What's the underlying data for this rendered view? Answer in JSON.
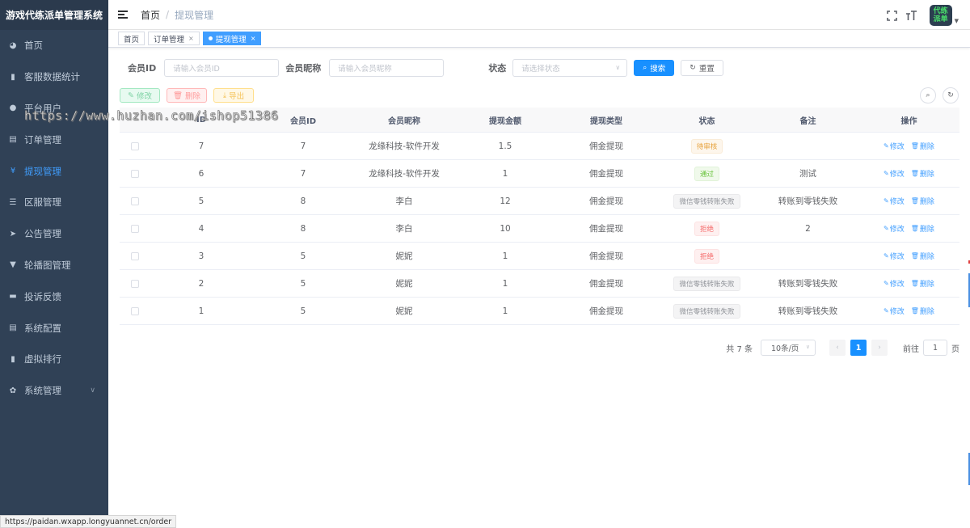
{
  "sidebar": {
    "logo": "游戏代练派单管理系统",
    "items": [
      {
        "label": "首页",
        "icon": "dashboard-icon",
        "glyph": "◕"
      },
      {
        "label": "客服数据统计",
        "icon": "chart-icon",
        "glyph": "▮"
      },
      {
        "label": "平台用户",
        "icon": "user-icon",
        "glyph": "●"
      },
      {
        "label": "订单管理",
        "icon": "order-icon",
        "glyph": "▤"
      },
      {
        "label": "提现管理",
        "icon": "yen-icon",
        "glyph": "¥"
      },
      {
        "label": "区服管理",
        "icon": "list-icon",
        "glyph": "☰"
      },
      {
        "label": "公告管理",
        "icon": "send-icon",
        "glyph": "➤"
      },
      {
        "label": "轮播图管理",
        "icon": "shirt-icon",
        "glyph": "▼"
      },
      {
        "label": "投诉反馈",
        "icon": "message-icon",
        "glyph": "▬"
      },
      {
        "label": "系统配置",
        "icon": "document-icon",
        "glyph": "▤"
      },
      {
        "label": "虚拟排行",
        "icon": "ranking-icon",
        "glyph": "▮"
      },
      {
        "label": "系统管理",
        "icon": "gear-icon",
        "glyph": "✿"
      }
    ],
    "active_index": 4
  },
  "header": {
    "breadcrumb": [
      "首页",
      "提现管理"
    ],
    "avatar_text": [
      "代练",
      "派单"
    ]
  },
  "tags": [
    {
      "label": "首页",
      "closable": false
    },
    {
      "label": "订单管理",
      "closable": true
    },
    {
      "label": "提现管理",
      "closable": true,
      "active": true
    }
  ],
  "search": {
    "member_id_label": "会员ID",
    "member_id_placeholder": "请输入会员ID",
    "nickname_label": "会员昵称",
    "nickname_placeholder": "请输入会员昵称",
    "status_label": "状态",
    "status_placeholder": "请选择状态",
    "search_btn": "搜索",
    "reset_btn": "重置"
  },
  "toolbar": {
    "edit": "修改",
    "delete": "删除",
    "export": "导出"
  },
  "table": {
    "columns": [
      "ID",
      "会员ID",
      "会员昵称",
      "提现金额",
      "提现类型",
      "状态",
      "备注",
      "操作"
    ],
    "rows": [
      {
        "id": "7",
        "member_id": "7",
        "nickname": "龙缘科技-软件开发",
        "amount": "1.5",
        "type": "佣金提现",
        "status": "待审核",
        "status_kind": "warn",
        "remark": ""
      },
      {
        "id": "6",
        "member_id": "7",
        "nickname": "龙缘科技-软件开发",
        "amount": "1",
        "type": "佣金提现",
        "status": "通过",
        "status_kind": "succ",
        "remark": "测试"
      },
      {
        "id": "5",
        "member_id": "8",
        "nickname": "李白",
        "amount": "12",
        "type": "佣金提现",
        "status": "微信零钱转账失败",
        "status_kind": "info",
        "remark": "转账到零钱失败"
      },
      {
        "id": "4",
        "member_id": "8",
        "nickname": "李白",
        "amount": "10",
        "type": "佣金提现",
        "status": "拒绝",
        "status_kind": "dang",
        "remark": "2"
      },
      {
        "id": "3",
        "member_id": "5",
        "nickname": "妮妮",
        "amount": "1",
        "type": "佣金提现",
        "status": "拒绝",
        "status_kind": "dang",
        "remark": ""
      },
      {
        "id": "2",
        "member_id": "5",
        "nickname": "妮妮",
        "amount": "1",
        "type": "佣金提现",
        "status": "微信零钱转账失败",
        "status_kind": "info",
        "remark": "转账到零钱失败"
      },
      {
        "id": "1",
        "member_id": "5",
        "nickname": "妮妮",
        "amount": "1",
        "type": "佣金提现",
        "status": "微信零钱转账失败",
        "status_kind": "info",
        "remark": "转账到零钱失败"
      }
    ],
    "op_edit": "修改",
    "op_delete": "删除"
  },
  "pagination": {
    "total_text": "共 7 条",
    "page_size": "10条/页",
    "current_page": "1",
    "goto_label": "前往",
    "goto_value": "1",
    "page_unit": "页"
  },
  "watermark": "https://www.huzhan.com/ishop51386",
  "status_url": "https://paidan.wxapp.longyuannet.cn/order"
}
